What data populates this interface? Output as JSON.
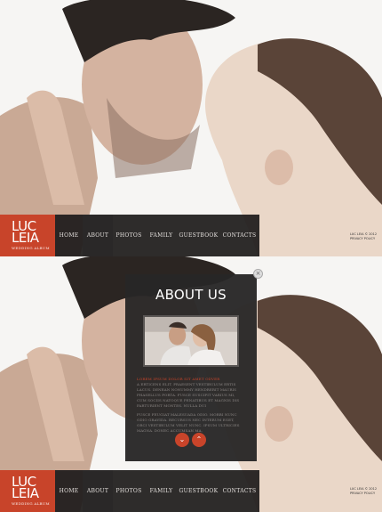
{
  "logo": {
    "line1": "LUC",
    "line2": "LEIA",
    "subtitle": "WEDDING ALBUM"
  },
  "nav": {
    "items": [
      {
        "label": "HOME"
      },
      {
        "label": "ABOUT"
      },
      {
        "label": "PHOTOS"
      },
      {
        "label": "FAMILY"
      },
      {
        "label": "GUESTBOOK"
      },
      {
        "label": "CONTACTS"
      }
    ]
  },
  "footer": {
    "copyright_line1": "LUC LEIA © 2012",
    "copyright_line2": "PRIVACY POLICY"
  },
  "about_modal": {
    "title": "ABOUT US",
    "close_glyph": "×",
    "heading": "LOREM IPSUM DOLOR SIT AMET ODVER",
    "paragraph1": "A ERTICENS ELIT. PRAESENT VESTIBULUM ERTIS LACUS. DENEAN NONUMMY HENDRERIT MAURIS PHASELLUS PORTA. FUSCE SUSCIPIT VARIUS MI, CUM SOCIIS NATOQUE PENATIBUS ET MAGNIS DIS PARTURIENT MONTES. NULLA DUI",
    "paragraph2": "FUSCE FEUGIAT MALESUADA ODIO. MORBI NUNC ODIO GRAVIDA. RECURSUS NEC INTERUM EGET, ORCI VESTIBULUM VELIT NUNC. IPSUM ULTRICIES MAGNA. DONEC ACCUMSAN MA,",
    "prev_glyph": "⌄",
    "next_glyph": "⌃"
  },
  "colors": {
    "accent": "#c8442a",
    "nav_bg": "#1c1a1a",
    "modal_bg": "#282626"
  }
}
